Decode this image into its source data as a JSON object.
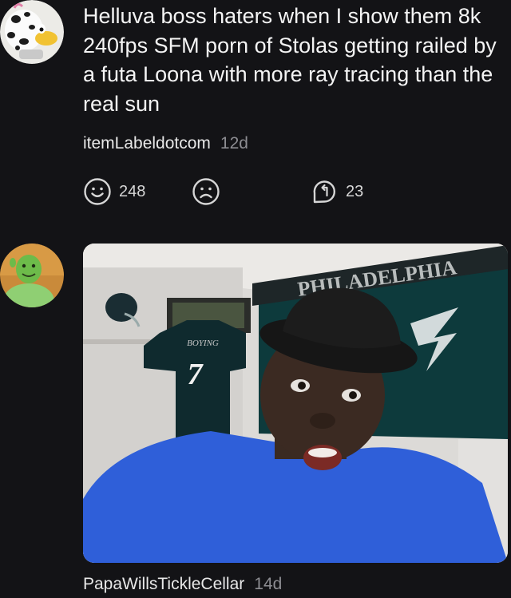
{
  "post": {
    "text": "Helluva boss haters when I show them 8k 240fps SFM porn of Stolas getting railed by a futa Loona with more ray tracing than the real sun",
    "username": "itemLabeldotcom",
    "time": "12d",
    "like_count": "248",
    "reply_count": "23"
  },
  "reply": {
    "username": "PapaWillsTickleCellar",
    "time": "14d",
    "image": {
      "banner_text": "PHILADELPHIA",
      "jersey_name": "BOYING",
      "jersey_number": "7"
    }
  },
  "colors": {
    "background": "#131316",
    "meta_gray": "#8d8d92",
    "shirt_blue": "#2f5fd9"
  },
  "icons": [
    "cow-avatar-icon",
    "smile-icon",
    "frown-icon",
    "reply-icon",
    "ogre-avatar-icon"
  ]
}
